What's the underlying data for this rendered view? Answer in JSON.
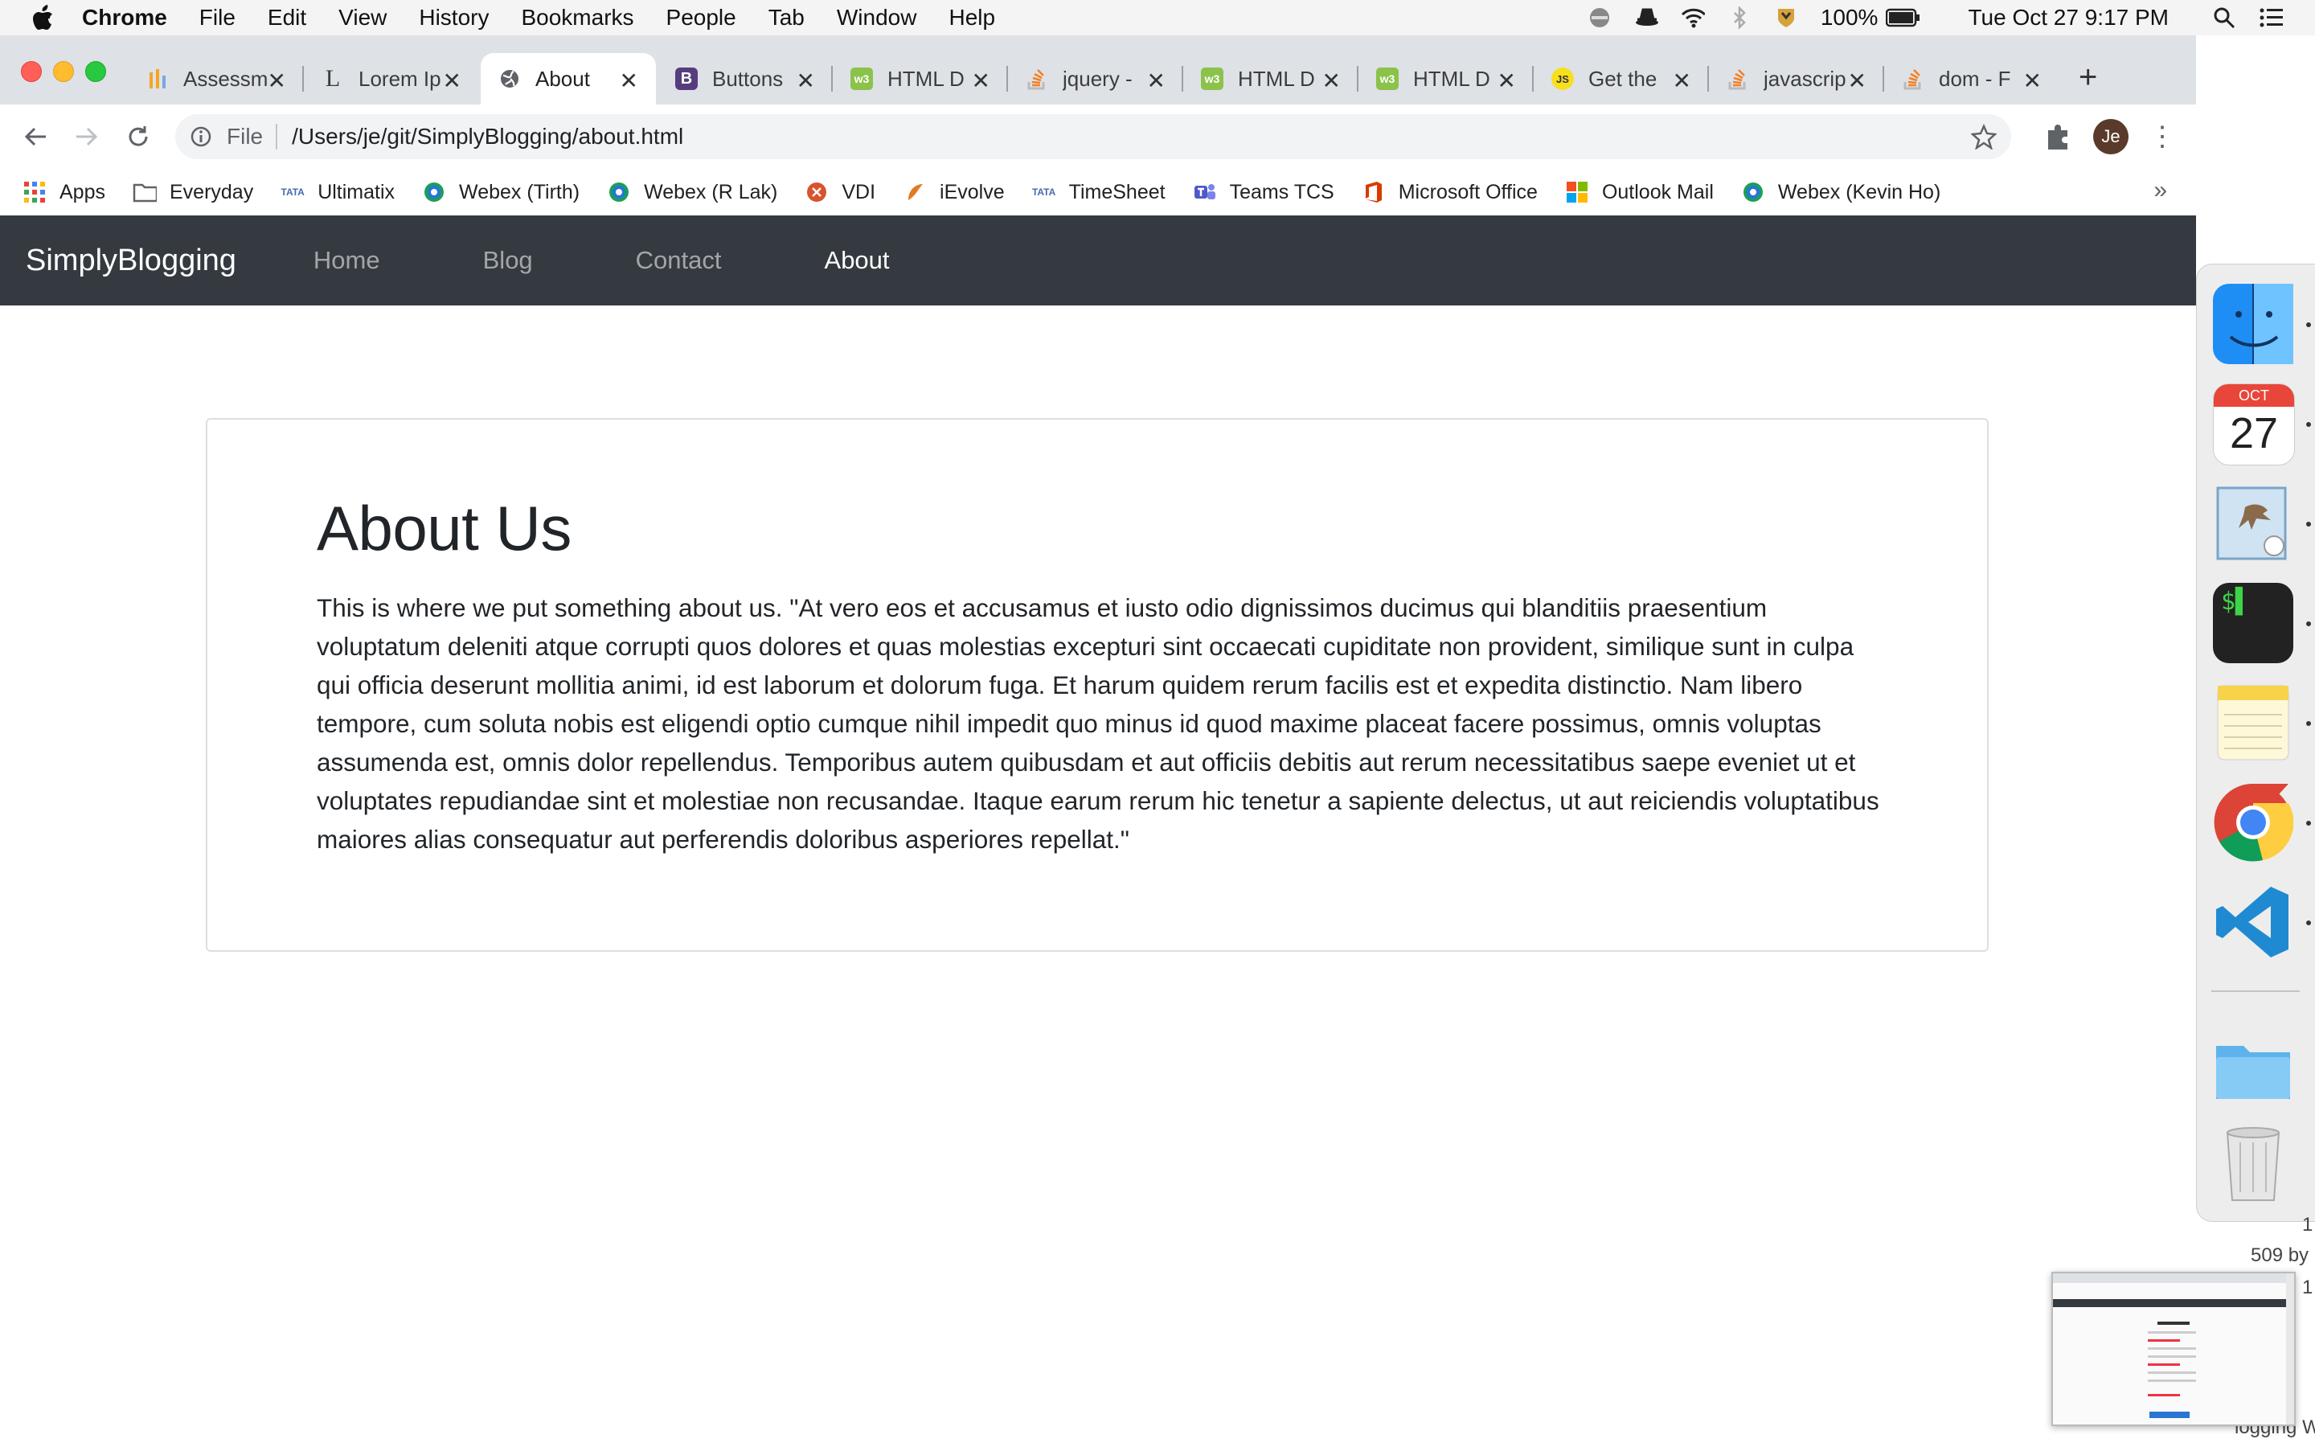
{
  "menubar": {
    "app_name": "Chrome",
    "menus": [
      "File",
      "Edit",
      "View",
      "History",
      "Bookmarks",
      "People",
      "Tab",
      "Window",
      "Help"
    ],
    "battery": "100%",
    "clock": "Tue Oct 27  9:17 PM"
  },
  "tabs": [
    {
      "title": "Assessm",
      "icon": "assessment-icon"
    },
    {
      "title": "Lorem Ip",
      "icon": "lorem-ipsum-icon"
    },
    {
      "title": "About",
      "icon": "globe-icon",
      "active": true
    },
    {
      "title": "Buttons",
      "icon": "bootstrap-icon"
    },
    {
      "title": "HTML D",
      "icon": "w3-icon"
    },
    {
      "title": "jquery -",
      "icon": "stackoverflow-icon"
    },
    {
      "title": "HTML D",
      "icon": "w3-icon"
    },
    {
      "title": "HTML D",
      "icon": "w3-icon"
    },
    {
      "title": "Get the",
      "icon": "javascript-icon"
    },
    {
      "title": "javascrip",
      "icon": "stackoverflow-icon"
    },
    {
      "title": "dom - F",
      "icon": "stackoverflow-icon"
    }
  ],
  "toolbar": {
    "scheme_label": "File",
    "url": "/Users/je/git/SimplyBlogging/about.html",
    "avatar_initials": "Je"
  },
  "bookmarks": [
    {
      "label": "Apps",
      "icon": "apps-grid-icon"
    },
    {
      "label": "Everyday",
      "icon": "folder-icon"
    },
    {
      "label": "Ultimatix",
      "icon": "tata-icon"
    },
    {
      "label": "Webex (Tirth)",
      "icon": "webex-icon"
    },
    {
      "label": "Webex (R Lak)",
      "icon": "webex-icon"
    },
    {
      "label": "VDI",
      "icon": "vdi-icon"
    },
    {
      "label": "iEvolve",
      "icon": "ievolve-icon"
    },
    {
      "label": "TimeSheet",
      "icon": "tata-icon"
    },
    {
      "label": "Teams TCS",
      "icon": "teams-icon"
    },
    {
      "label": "Microsoft Office",
      "icon": "office-icon"
    },
    {
      "label": "Outlook Mail",
      "icon": "microsoft-icon"
    },
    {
      "label": "Webex (Kevin Ho)",
      "icon": "webex-icon"
    }
  ],
  "bookmarks_more": "»",
  "site": {
    "brand": "SimplyBlogging",
    "nav": [
      {
        "label": "Home",
        "active": false
      },
      {
        "label": "Blog",
        "active": false
      },
      {
        "label": "Contact",
        "active": false
      },
      {
        "label": "About",
        "active": true
      }
    ],
    "heading": "About Us",
    "body": "This is where we put something about us. \"At vero eos et accusamus et iusto odio dignissimos ducimus qui blanditiis praesentium voluptatum deleniti atque corrupti quos dolores et quas molestias excepturi sint occaecati cupiditate non provident, similique sunt in culpa qui officia deserunt mollitia animi, id est laborum et dolorum fuga. Et harum quidem rerum facilis est et expedita distinctio. Nam libero tempore, cum soluta nobis est eligendi optio cumque nihil impedit quo minus id quod maxime placeat facere possimus, omnis voluptas assumenda est, omnis dolor repellendus. Temporibus autem quibusdam et aut officiis debitis aut rerum necessitatibus saepe eveniet ut et voluptates repudiandae sint et molestiae non recusandae. Itaque earum rerum hic tenetur a sapiente delectus, ut aut reiciendis voluptatibus maiores alias consequatur aut perferendis doloribus asperiores repellat.\""
  },
  "dock": {
    "calendar_month": "OCT",
    "calendar_day": "27",
    "apps": [
      "finder-icon",
      "calendar-icon",
      "mail-icon",
      "terminal-icon",
      "notes-icon",
      "chrome-icon",
      "vscode-icon",
      "folder-icon",
      "trash-icon"
    ]
  },
  "desktop": {
    "fragment_1": "1",
    "fragment_2": "509 by",
    "fragment_3": "1",
    "fragment_4": "logging Write"
  },
  "colors": {
    "site_navbar": "#343a40",
    "tabstrip": "#dee1e6",
    "text": "#212529"
  }
}
